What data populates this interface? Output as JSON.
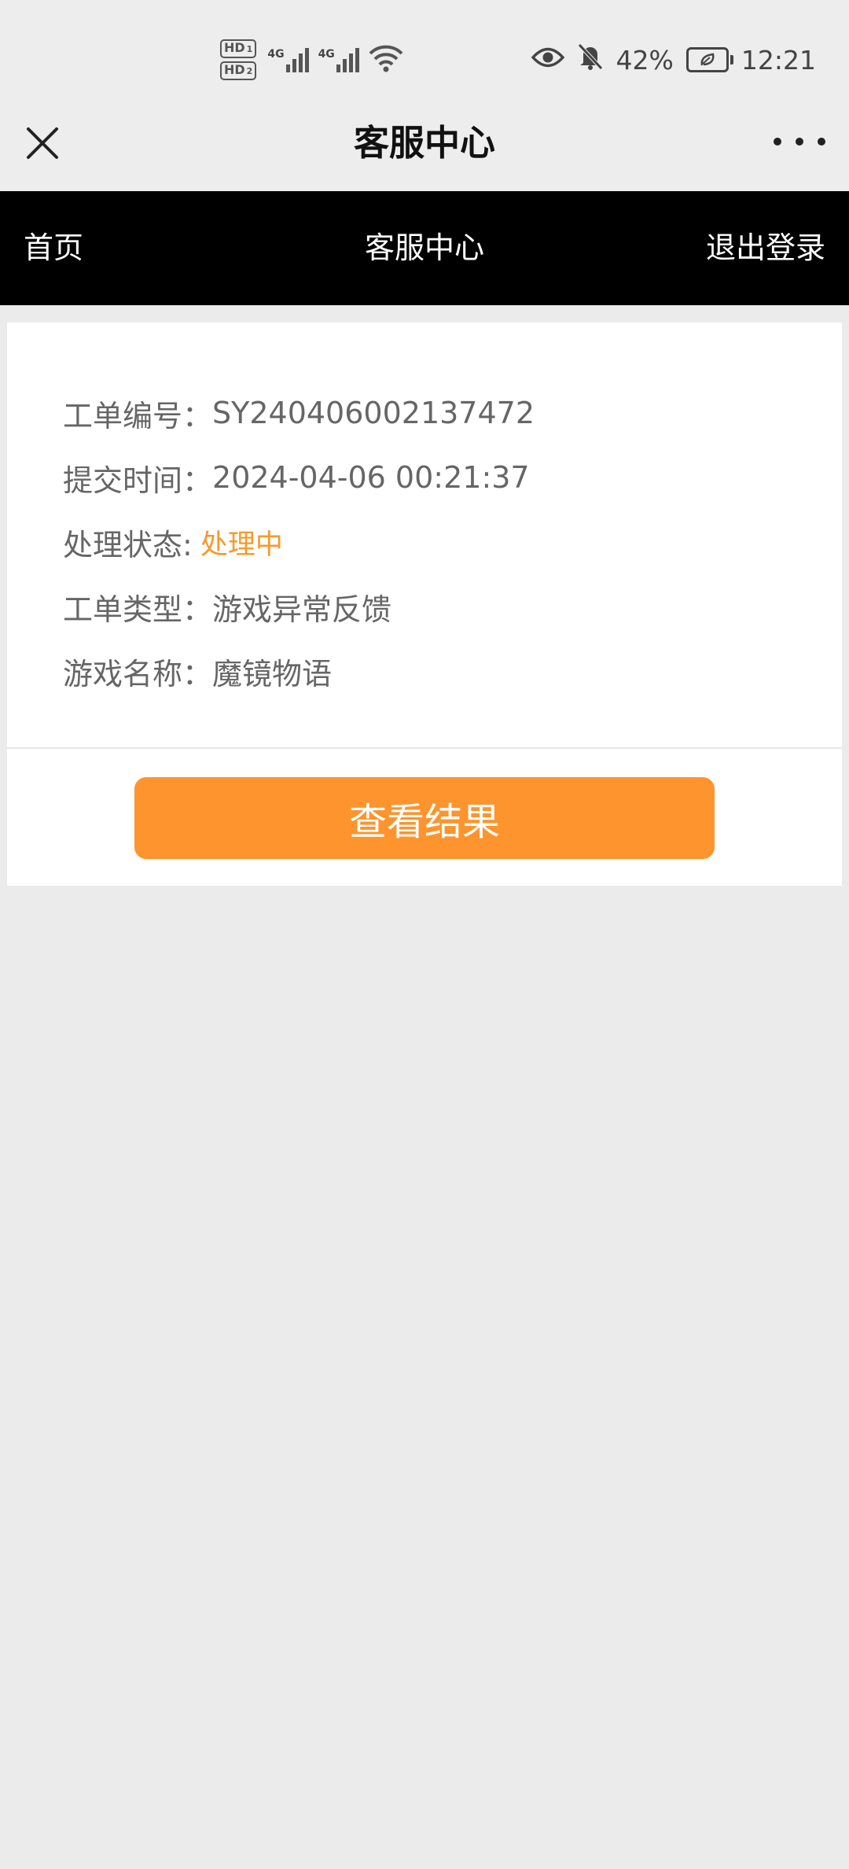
{
  "status_bar": {
    "sim1_badge": "HD",
    "sim1_index": "1",
    "sim2_badge": "HD",
    "sim2_index": "2",
    "network1": "4G",
    "network2": "4G",
    "battery_percent": "42%",
    "time": "12:21"
  },
  "title_bar": {
    "title": "客服中心"
  },
  "nav": {
    "home": "首页",
    "center": "客服中心",
    "logout": "退出登录"
  },
  "ticket": {
    "number_label": "工单编号：",
    "number_value": "SY240406002137472",
    "submit_label": "提交时间：",
    "submit_value": "2024-04-06 00:21:37",
    "status_label": "处理状态:",
    "status_value": "处理中",
    "type_label": "工单类型：",
    "type_value": "游戏异常反馈",
    "game_label": "游戏名称：",
    "game_value": "魔镜物语"
  },
  "actions": {
    "view_result": "查看结果"
  },
  "colors": {
    "accent_orange": "#fe942d",
    "status_orange": "#f59a2c",
    "nav_background": "#000000",
    "page_background": "#ebebeb"
  },
  "icons": {
    "close": "close-icon",
    "more": "more-icon",
    "wifi": "wifi-icon",
    "eye": "eye-icon",
    "mute": "bell-off-icon",
    "battery": "battery-icon"
  }
}
